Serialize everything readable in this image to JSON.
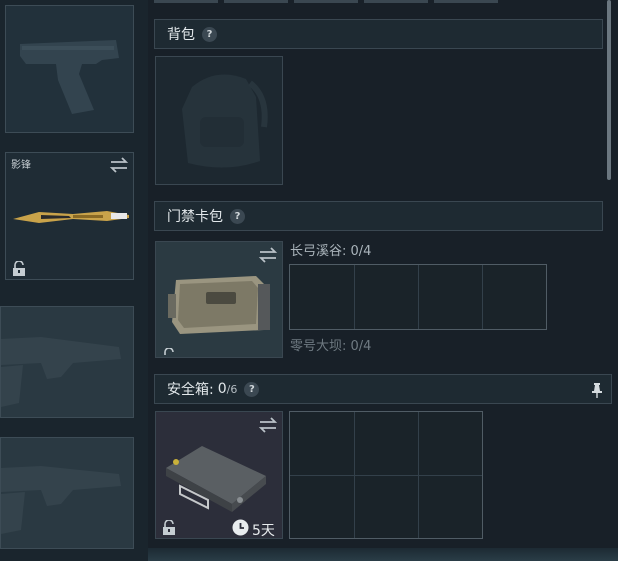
{
  "left": {
    "weapon_slot_2": {
      "name": "影锋"
    }
  },
  "sections": {
    "backpack": {
      "title": "背包",
      "help": "?"
    },
    "keycard": {
      "title": "门禁卡包",
      "help": "?",
      "map1": "长弓溪谷: 0/4",
      "map2": "零号大坝: 0/4"
    },
    "safebox": {
      "title": "安全箱:",
      "used": "0",
      "capacity": "/6",
      "help": "?",
      "timer": "5天"
    }
  }
}
